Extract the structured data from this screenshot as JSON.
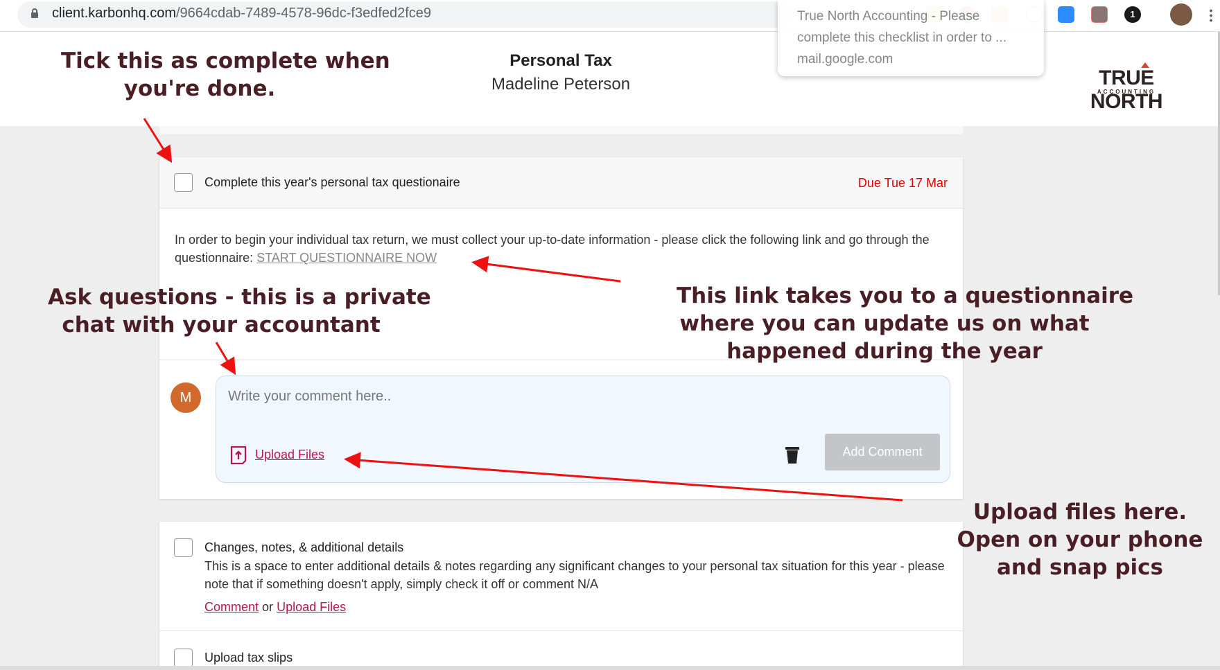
{
  "browser": {
    "url_domain": "client.karbonhq.com",
    "url_path": "/9664cdab-7489-4578-96dc-f3edfed2fce9",
    "notification": {
      "title": "True North Accounting - Please",
      "body": "complete this checklist in order to ...",
      "source": "mail.google.com"
    },
    "extension_badge": "1"
  },
  "header": {
    "title": "Personal Tax",
    "client_name": "Madeline Peterson",
    "logo_text": "TRUE NORTH",
    "logo_subtext": "ACCOUNTING"
  },
  "tasks": [
    {
      "title": "Complete this year's personal tax questionaire",
      "due": "Due Tue 17 Mar",
      "body_text": "In order to begin your individual tax return, we must collect your up-to-date information - please click the following link and go through the questionnaire: ",
      "link_text": "START QUESTIONNAIRE NOW",
      "completed": false
    },
    {
      "title": "Changes, notes, & additional details",
      "description": "This is a space to enter additional details & notes regarding any significant changes to your personal tax situation for this year - please note that if something doesn't apply, simply check it off or comment N/A",
      "comment_link": "Comment",
      "or_text": "or",
      "upload_link": "Upload Files",
      "completed": false
    },
    {
      "title": "Upload tax slips",
      "completed": false
    }
  ],
  "comment": {
    "avatar_initial": "M",
    "placeholder": "Write your comment here..",
    "upload_label": "Upload Files",
    "add_label": "Add Comment"
  },
  "annotations": {
    "tick": [
      "Tick this as complete when",
      "you're done."
    ],
    "ask": [
      "Ask questions - this is a private",
      "chat with your accountant"
    ],
    "link": [
      "This link takes you to a questionnaire",
      "where you can update us on what",
      "happened during the year"
    ],
    "upload": [
      "Upload files here.",
      "Open on your phone",
      "and snap pics"
    ]
  },
  "colors": {
    "due": "#e00000",
    "link": "#b8174e",
    "avatar": "#d2692c",
    "annotation": "#4a1e25",
    "arrow": "#ee1111"
  }
}
